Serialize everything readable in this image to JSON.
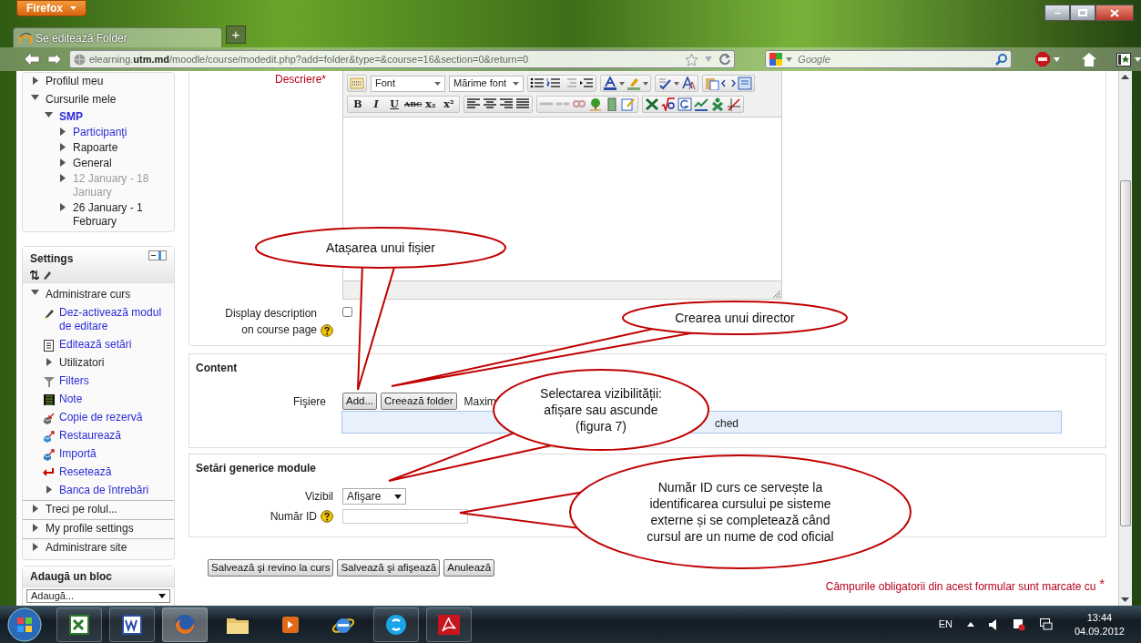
{
  "browser": {
    "menu_button": "Firefox",
    "tab": {
      "title": "Se editează Folder",
      "selected": true
    },
    "new_tab": "+",
    "url": "elearning.**utm.md**/moodle/course/modedit.php?add=folder&type=&course=16&section=0&return=0",
    "search": {
      "placeholder": "Google"
    }
  },
  "navigation": {
    "items": [
      {
        "label": "Profilul meu",
        "kind": "branch",
        "expanded": false
      },
      {
        "label": "Cursurile mele",
        "kind": "branch",
        "expanded": true,
        "children": [
          {
            "label": "SMP",
            "kind": "current",
            "expanded": true,
            "children": [
              {
                "label": "Participanţi",
                "kind": "link",
                "expanded": false
              },
              {
                "label": "Rapoarte",
                "kind": "branch",
                "expanded": false
              },
              {
                "label": "General",
                "kind": "branch",
                "expanded": false
              },
              {
                "label": "12 January - 18 January",
                "kind": "dimmed",
                "expanded": false
              },
              {
                "label": "26 January - 1 February",
                "kind": "branch",
                "expanded": false
              }
            ]
          }
        ]
      }
    ]
  },
  "settings": {
    "title": "Settings",
    "items": [
      {
        "label": "Administrare curs",
        "kind": "branch",
        "expanded": true,
        "children": [
          {
            "label": "Dez-activează modul de editare",
            "kind": "edit"
          },
          {
            "label": "Editează setări",
            "kind": "settings"
          },
          {
            "label": "Utilizatori",
            "kind": "branch",
            "expanded": false
          },
          {
            "label": "Filters",
            "kind": "filter"
          },
          {
            "label": "Note",
            "kind": "grades"
          },
          {
            "label": "Copie de rezervă",
            "kind": "backup"
          },
          {
            "label": "Restaurează",
            "kind": "restore"
          },
          {
            "label": "Importă",
            "kind": "import"
          },
          {
            "label": "Resetează",
            "kind": "reset"
          },
          {
            "label": "Banca de întrebări",
            "kind": "link",
            "expanded": false
          }
        ]
      },
      {
        "label": "Treci pe rolul...",
        "kind": "branch",
        "expanded": false
      },
      {
        "label": "My profile settings",
        "kind": "branch",
        "expanded": false
      },
      {
        "label": "Administrare site",
        "kind": "branch",
        "expanded": false
      }
    ]
  },
  "add_block": {
    "title": "Adaugă un bloc",
    "select": "Adaugă..."
  },
  "form": {
    "description": {
      "label": "Descriere",
      "mark": "*"
    },
    "editor": {
      "font": "Font",
      "size": "Mărime font",
      "format_buttons": [
        "B",
        "I",
        "U",
        "ABC",
        "x₂",
        "x²"
      ]
    },
    "display_description": {
      "label": "Display description on course page",
      "checked": false
    },
    "content": {
      "legend": "Content",
      "files_label": "Fişiere",
      "buttons": [
        "Add...",
        "Creează folder"
      ],
      "note": "Maxim",
      "drop_text": "ched"
    },
    "generic": {
      "legend": "Setări generice module",
      "visible_label": "Vizibil",
      "visible_value": "Afişare",
      "id_label": "Număr ID"
    }
  },
  "actions": [
    "Salvează şi revino la curs",
    "Salvează şi afişează",
    "Anulează"
  ],
  "required_note": {
    "text": "Câmpurile obligatorii din acest formular sunt marcate cu",
    "mark": "*"
  },
  "callouts": [
    {
      "text": "Atașarea unui fișier"
    },
    {
      "text": "Crearea unui director"
    },
    {
      "text": "Selectarea vizibilității: afișare sau ascunde (figura 7)"
    },
    {
      "text": "Număr ID curs ce servește la identificarea cursului pe sisteme externe și se completează când cursul are un nume de cod oficial"
    }
  ],
  "taskbar": {
    "language": "EN",
    "time": "13:44",
    "date": "04.09.2012"
  }
}
